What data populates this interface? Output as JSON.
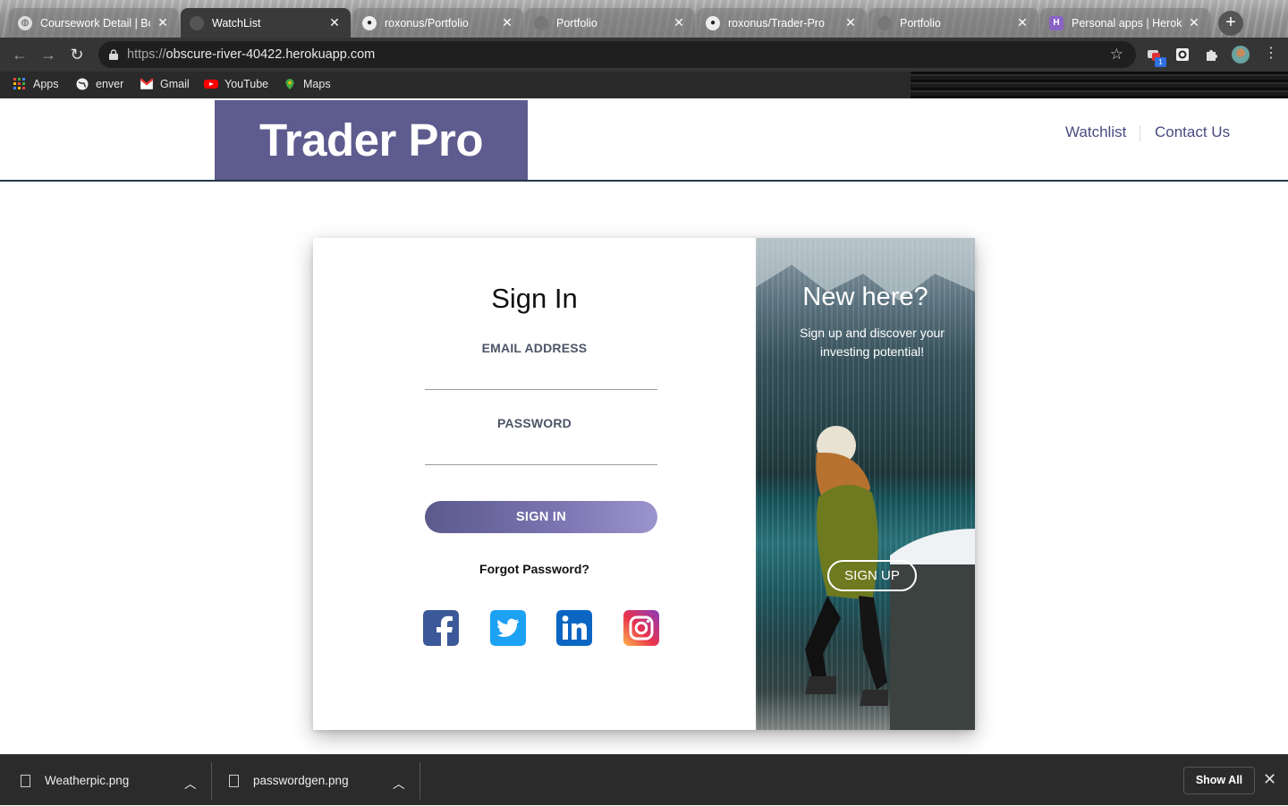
{
  "browser": {
    "tabs": [
      {
        "label": "Coursework Detail | Bo",
        "icon": "globe-icon",
        "active": false
      },
      {
        "label": "WatchList",
        "icon": "globe-icon",
        "active": true
      },
      {
        "label": "roxonus/Portfolio",
        "icon": "github-icon",
        "active": false
      },
      {
        "label": "Portfolio",
        "icon": "globe-icon",
        "active": false
      },
      {
        "label": "roxonus/Trader-Pro",
        "icon": "github-icon",
        "active": false
      },
      {
        "label": "Portfolio",
        "icon": "globe-icon",
        "active": false
      },
      {
        "label": "Personal apps | Herok",
        "icon": "heroku-icon",
        "active": false
      }
    ],
    "url_scheme": "https://",
    "url_host": "obscure-river-40422.herokuapp.com",
    "bookmarks": [
      {
        "label": "Apps",
        "icon": "apps-grid-icon"
      },
      {
        "label": "enver",
        "icon": "globe-icon"
      },
      {
        "label": "Gmail",
        "icon": "gmail-icon"
      },
      {
        "label": "YouTube",
        "icon": "youtube-icon"
      },
      {
        "label": "Maps",
        "icon": "maps-icon"
      }
    ],
    "extension_badge": "1"
  },
  "site": {
    "logo": "Trader Pro",
    "nav": [
      {
        "label": "Watchlist"
      },
      {
        "label": "Contact Us"
      }
    ]
  },
  "signin": {
    "title": "Sign In",
    "email_label": "EMAIL ADDRESS",
    "password_label": "PASSWORD",
    "button": "SIGN IN",
    "forgot": "Forgot Password?",
    "social": [
      "facebook-icon",
      "twitter-icon",
      "linkedin-icon",
      "instagram-icon"
    ]
  },
  "promo": {
    "title": "New here?",
    "subtitle": "Sign up and discover your investing potential!",
    "button": "SIGN UP"
  },
  "downloads": {
    "files": [
      {
        "name": "Weatherpic.png"
      },
      {
        "name": "passwordgen.png"
      }
    ],
    "show_all": "Show All"
  },
  "colors": {
    "brand": "#5e5b8e",
    "nav_link": "#4a4a80"
  }
}
